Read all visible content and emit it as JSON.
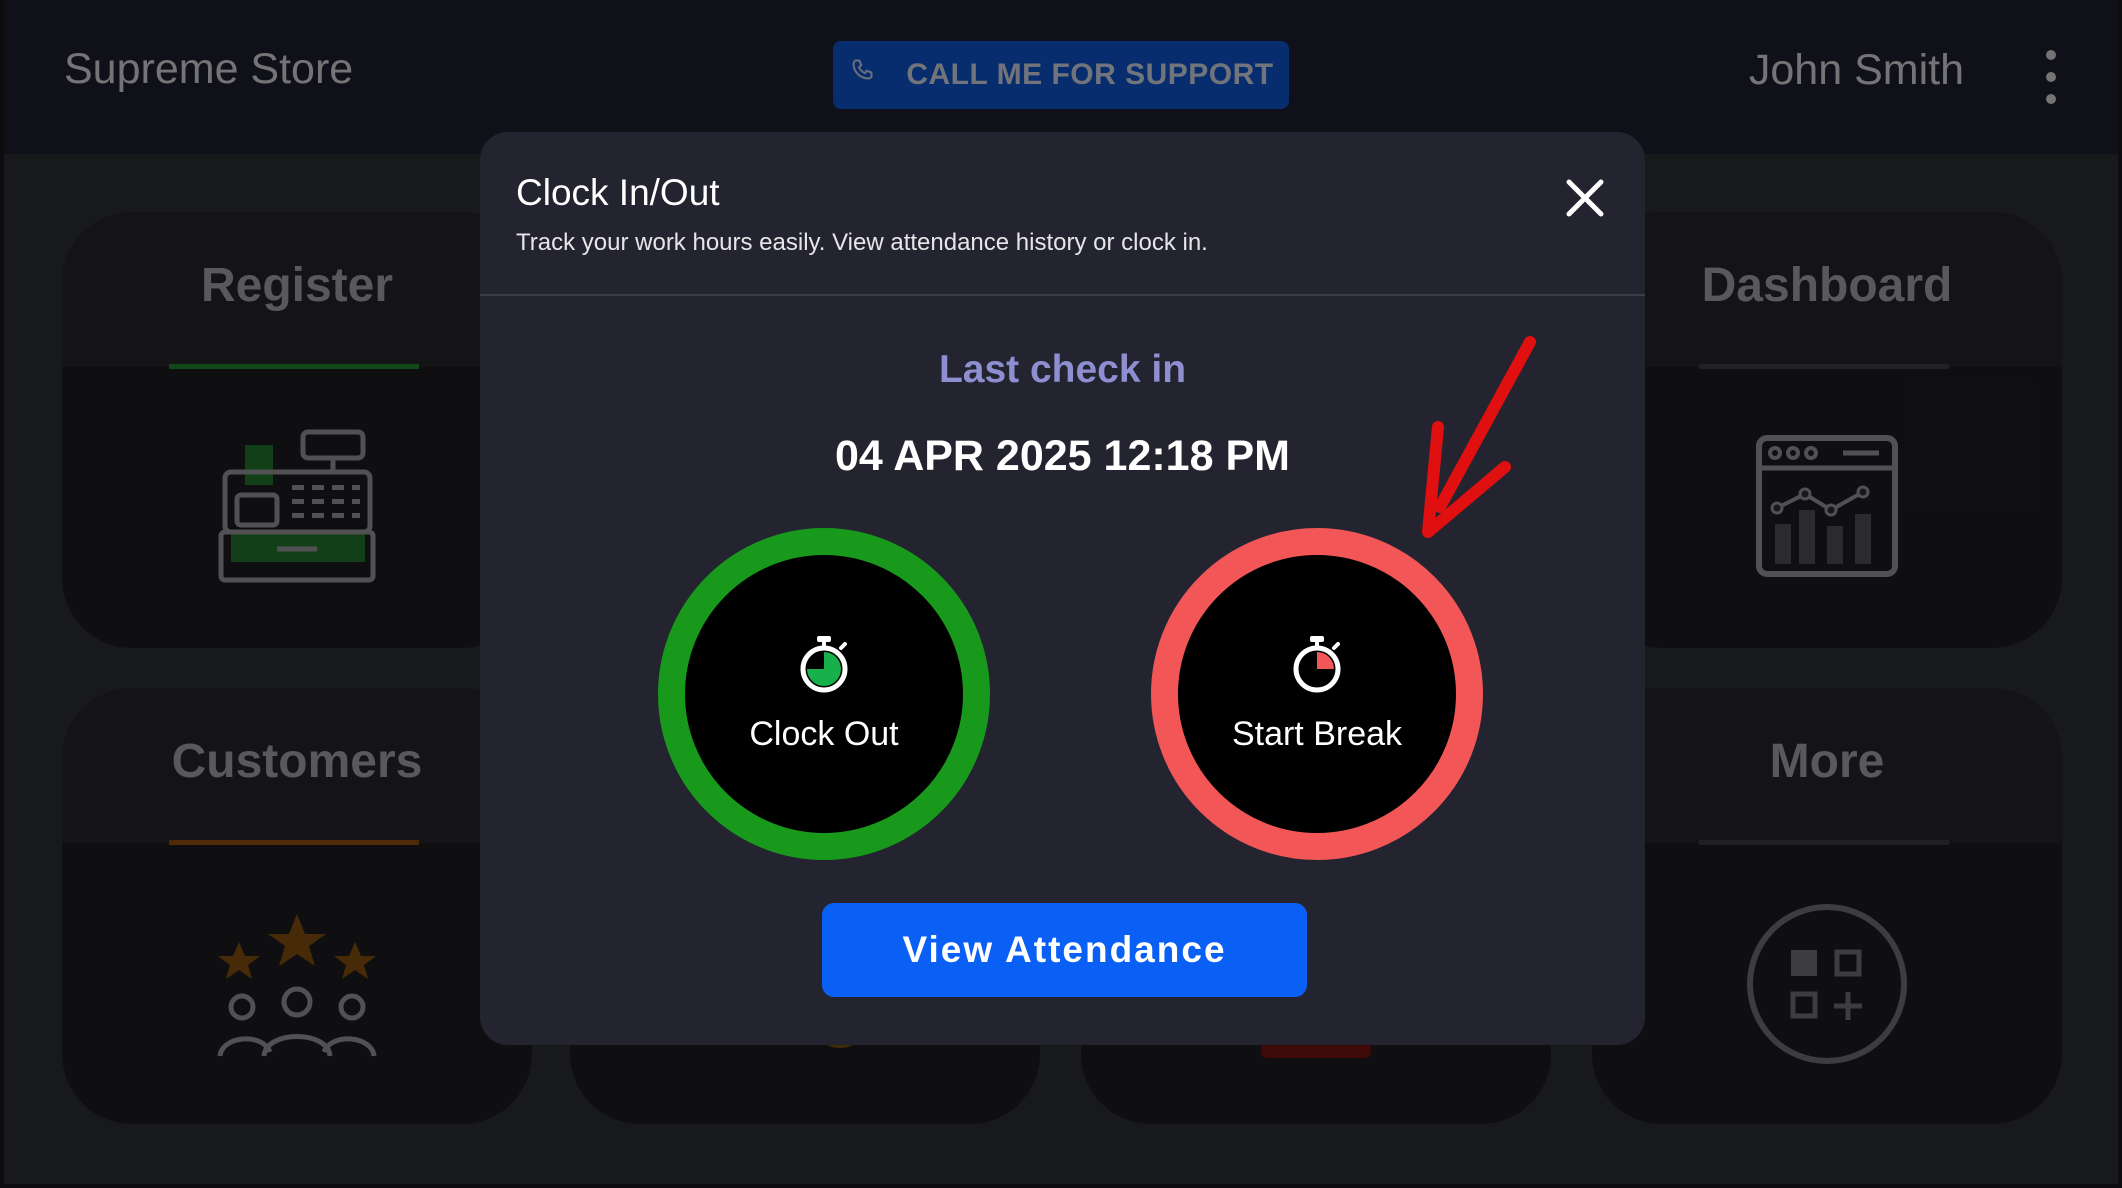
{
  "header": {
    "app_title": "Supreme Store",
    "support_label": "CALL ME FOR SUPPORT",
    "support_icon": "phone-icon",
    "user_name": "John Smith",
    "menu_icon": "kebab-menu-icon"
  },
  "tiles": [
    {
      "label": "Register",
      "accent": "#1f7a2d",
      "icon": "cash-register-icon"
    },
    {
      "label": "Dashboard",
      "accent": "#3a3a40",
      "icon": "analytics-dashboard-icon"
    },
    {
      "label": "Customers",
      "accent": "#8a4a10",
      "icon": "customers-rating-icon"
    },
    {
      "label": "More",
      "accent": "#3a3a40",
      "icon": "apps-add-icon"
    }
  ],
  "modal": {
    "title": "Clock In/Out",
    "subtitle": "Track your work hours easily. View attendance history or clock in.",
    "last_label": "Last check in",
    "last_time": "04 APR 2025 12:18 PM",
    "clock_out_label": "Clock Out",
    "start_break_label": "Start Break",
    "view_attendance_label": "View Attendance"
  },
  "colors": {
    "green_ring": "#18991b",
    "red_ring": "#f25656",
    "primary_button": "#0a60f5",
    "support_button": "#0f4fbf",
    "arrow": "#e01010"
  }
}
